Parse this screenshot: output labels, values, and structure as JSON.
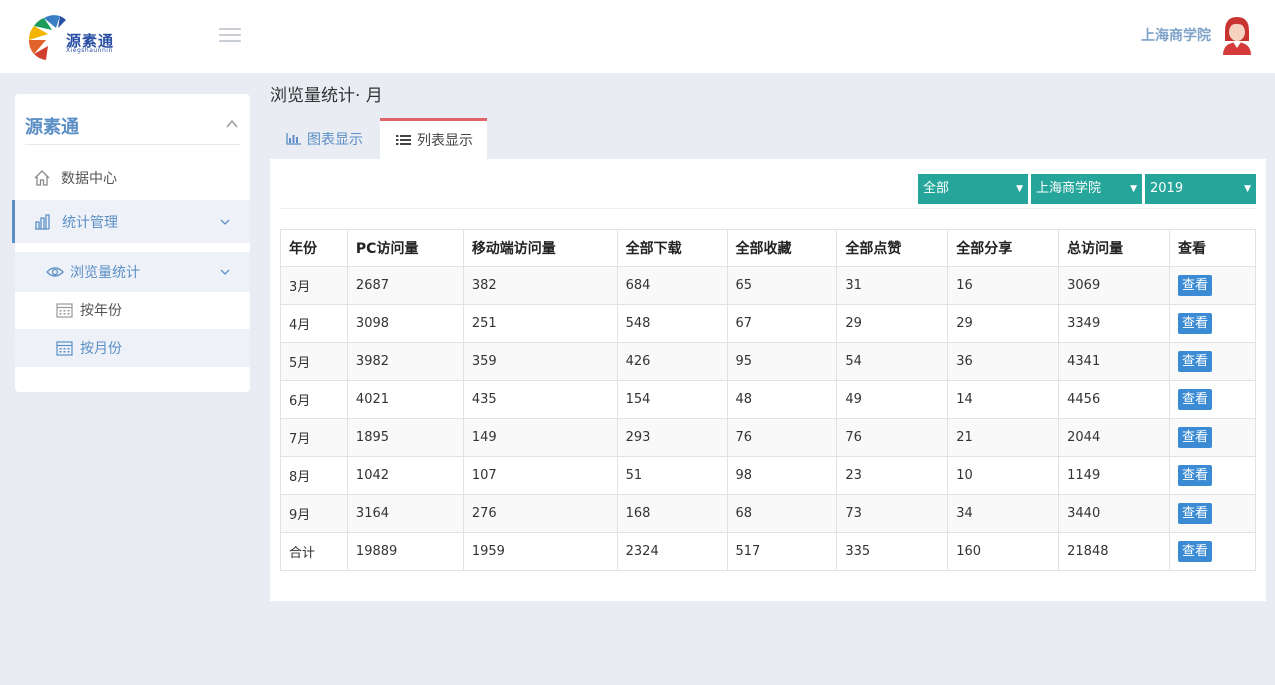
{
  "header": {
    "logo_text": "源素通",
    "logo_sub": "Xiegshaunnin",
    "user_name": "上海商学院"
  },
  "sidebar": {
    "title": "源素通",
    "items": [
      {
        "label": "数据中心",
        "icon": "home-icon"
      },
      {
        "label": "统计管理",
        "icon": "bar-chart-icon"
      },
      {
        "label": "浏览量统计",
        "icon": "eye-icon"
      },
      {
        "label": "按年份",
        "icon": "calendar-icon"
      },
      {
        "label": "按月份",
        "icon": "calendar-icon"
      }
    ]
  },
  "main": {
    "page_title": "浏览量统计· 月",
    "tabs": [
      {
        "label": "图表显示",
        "icon": "bar-chart-icon"
      },
      {
        "label": "列表显示",
        "icon": "list-icon"
      }
    ],
    "filters": {
      "type": "全部",
      "school": "上海商学院",
      "year": "2019"
    }
  },
  "table": {
    "headers": [
      "年份",
      "PC访问量",
      "移动端访问量",
      "全部下载",
      "全部收藏",
      "全部点赞",
      "全部分享",
      "总访问量",
      "查看"
    ],
    "view_label": "查看",
    "rows": [
      [
        "3月",
        "2687",
        "382",
        "684",
        "65",
        "31",
        "16",
        "3069"
      ],
      [
        "4月",
        "3098",
        "251",
        "548",
        "67",
        "29",
        "29",
        "3349"
      ],
      [
        "5月",
        "3982",
        "359",
        "426",
        "95",
        "54",
        "36",
        "4341"
      ],
      [
        "6月",
        "4021",
        "435",
        "154",
        "48",
        "49",
        "14",
        "4456"
      ],
      [
        "7月",
        "1895",
        "149",
        "293",
        "76",
        "76",
        "21",
        "2044"
      ],
      [
        "8月",
        "1042",
        "107",
        "51",
        "98",
        "23",
        "10",
        "1149"
      ],
      [
        "9月",
        "3164",
        "276",
        "168",
        "68",
        "73",
        "34",
        "3440"
      ],
      [
        "合计",
        "19889",
        "1959",
        "2324",
        "517",
        "335",
        "160",
        "21848"
      ]
    ]
  },
  "colors": {
    "accent": "#5b8fc5",
    "filter_bg": "#26a69a",
    "button": "#3b8bd4",
    "active_tab_border": "#e0636a"
  }
}
